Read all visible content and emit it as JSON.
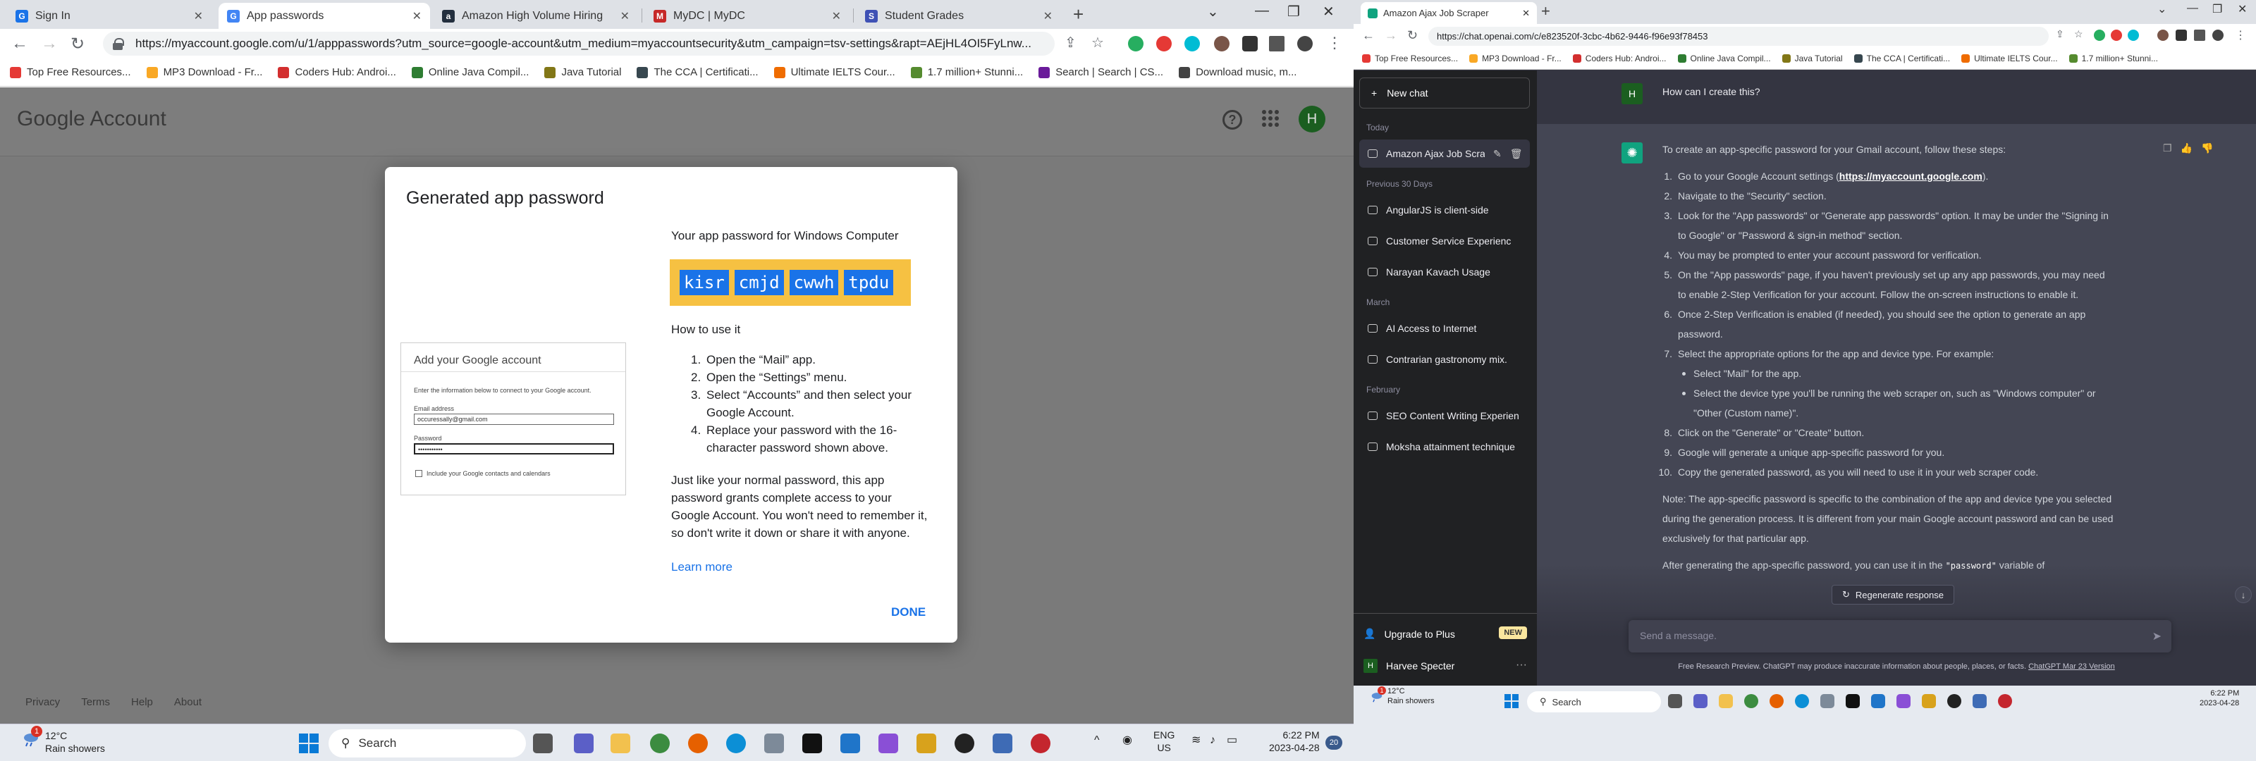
{
  "left": {
    "tabs": [
      {
        "title": "Sign In",
        "color": "#1a73e8"
      },
      {
        "title": "App passwords",
        "color": "#4285f4"
      },
      {
        "title": "Amazon High Volume Hiring",
        "color": "#232f3e"
      },
      {
        "title": "MyDC | MyDC",
        "color": "#c62828"
      },
      {
        "title": "Student Grades",
        "color": "#3f51b5"
      }
    ],
    "url": "https://myaccount.google.com/u/1/apppasswords?utm_source=google-account&utm_medium=myaccountsecurity&utm_campaign=tsv-settings&rapt=AEjHL4OI5FyLnw...",
    "bookmarks": [
      "Top Free Resources...",
      "MP3 Download - Fr...",
      "Coders Hub: Androi...",
      "Online Java Compil...",
      "Java Tutorial",
      "The CCA | Certificati...",
      "Ultimate IELTS Cour...",
      "1.7 million+ Stunni...",
      "Search | Search | CS...",
      "Download music, m..."
    ],
    "google_logo": "Google Account",
    "avatar_letter": "H",
    "footer": [
      "Privacy",
      "Terms",
      "Help",
      "About"
    ],
    "dialog": {
      "title": "Generated app password",
      "pw_heading": "Your app password for Windows Computer",
      "password_words": [
        "kisr",
        "cmjd",
        "cwwh",
        "tpdu"
      ],
      "howto": "How to use it",
      "steps": [
        "Open the “Mail” app.",
        "Open the “Settings” menu.",
        "Select “Accounts” and then select your Google Account.",
        "Replace your password with the 16-character password shown above."
      ],
      "note": "Just like your normal password, this app password grants complete access to your Google Account. You won't need to remember it, so don't write it down or share it with anyone.",
      "learn_more": "Learn more",
      "done": "DONE",
      "form": {
        "heading": "Add your Google account",
        "instructions": "Enter the information below to connect to your Google account.",
        "email_label": "Email address",
        "email_value": "occuressally@gmail.com",
        "password_label": "Password",
        "password_value": "•••••••••••",
        "checkbox_label": "Include your Google contacts and calendars"
      }
    },
    "taskbar": {
      "weather_temp": "12°C",
      "weather_desc": "Rain showers",
      "search": "Search",
      "lang1": "ENG",
      "lang2": "US",
      "time": "6:22 PM",
      "date": "2023-04-28",
      "badge": "20",
      "notif": "1"
    }
  },
  "right": {
    "tab_title": "Amazon Ajax Job Scraper",
    "url": "https://chat.openai.com/c/e823520f-3cbc-4b62-9446-f96e93f78453",
    "bookmarks": [
      "Top Free Resources...",
      "MP3 Download - Fr...",
      "Coders Hub: Androi...",
      "Online Java Compil...",
      "Java Tutorial",
      "The CCA | Certificati...",
      "Ultimate IELTS Cour...",
      "1.7 million+ Stunni..."
    ],
    "sidebar": {
      "new_chat": "New chat",
      "today": "Today",
      "active_chat": "Amazon Ajax Job Scrap",
      "prev30": "Previous 30 Days",
      "prev30_chats": [
        "AngularJS is client-side",
        "Customer Service Experienc",
        "Narayan Kavach Usage"
      ],
      "march": "March",
      "march_chats": [
        "AI Access to Internet",
        "Contrarian gastronomy mix."
      ],
      "february": "February",
      "feb_chats": [
        "SEO Content Writing Experien",
        "Moksha attainment technique"
      ],
      "upgrade": "Upgrade to Plus",
      "new_badge": "NEW",
      "user": "Harvee Specter",
      "user_letter": "H"
    },
    "chat": {
      "user_msg": "How can I create this?",
      "intro": "To create an app-specific password for your Gmail account, follow these steps:",
      "steps": [
        {
          "n": "1.",
          "pre": "Go to your Google Account settings (",
          "link": "https://myaccount.google.com",
          "post": ")."
        },
        {
          "n": "2.",
          "pre": "Navigate to the \"Security\" section."
        },
        {
          "n": "3.",
          "pre": "Look for the \"App passwords\" or \"Generate app passwords\" option. It may be under the \"Signing in to Google\" or \"Password & sign-in method\" section."
        },
        {
          "n": "4.",
          "pre": "You may be prompted to enter your account password for verification."
        },
        {
          "n": "5.",
          "pre": "On the \"App passwords\" page, if you haven't previously set up any app passwords, you may need to enable 2-Step Verification for your account. Follow the on-screen instructions to enable it."
        },
        {
          "n": "6.",
          "pre": "Once 2-Step Verification is enabled (if needed), you should see the option to generate an app password."
        },
        {
          "n": "7.",
          "pre": "Select the appropriate options for the app and device type. For example:"
        }
      ],
      "subs": [
        "Select \"Mail\" for the app.",
        "Select the device type you'll be running the web scraper on, such as \"Windows computer\" or \"Other (Custom name)\"."
      ],
      "steps2": [
        {
          "n": "8.",
          "pre": "Click on the \"Generate\" or \"Create\" button."
        },
        {
          "n": "9.",
          "pre": "Google will generate a unique app-specific password for you."
        },
        {
          "n": "10.",
          "pre": "Copy the generated password, as you will need to use it in your web scraper code."
        }
      ],
      "note": "Note: The app-specific password is specific to the combination of the app and device type you selected during the generation process. It is different from your main Google account password and can be used exclusively for that particular app.",
      "after_pre": "After generating the app-specific password, you can use it in the ",
      "after_code": "\"password\"",
      "after_post": " variable of",
      "regen": "Regenerate response",
      "input_placeholder": "Send a message.",
      "disclaimer": "Free Research Preview. ChatGPT may produce inaccurate information about people, places, or facts. ",
      "disclaimer_link": "ChatGPT Mar 23 Version"
    },
    "taskbar": {
      "weather_temp": "12°C",
      "weather_desc": "Rain showers",
      "search": "Search",
      "lang1": "ENG",
      "lang2": "US",
      "time": "6:22 PM",
      "date": "2023-04-28",
      "notif": "1"
    }
  }
}
